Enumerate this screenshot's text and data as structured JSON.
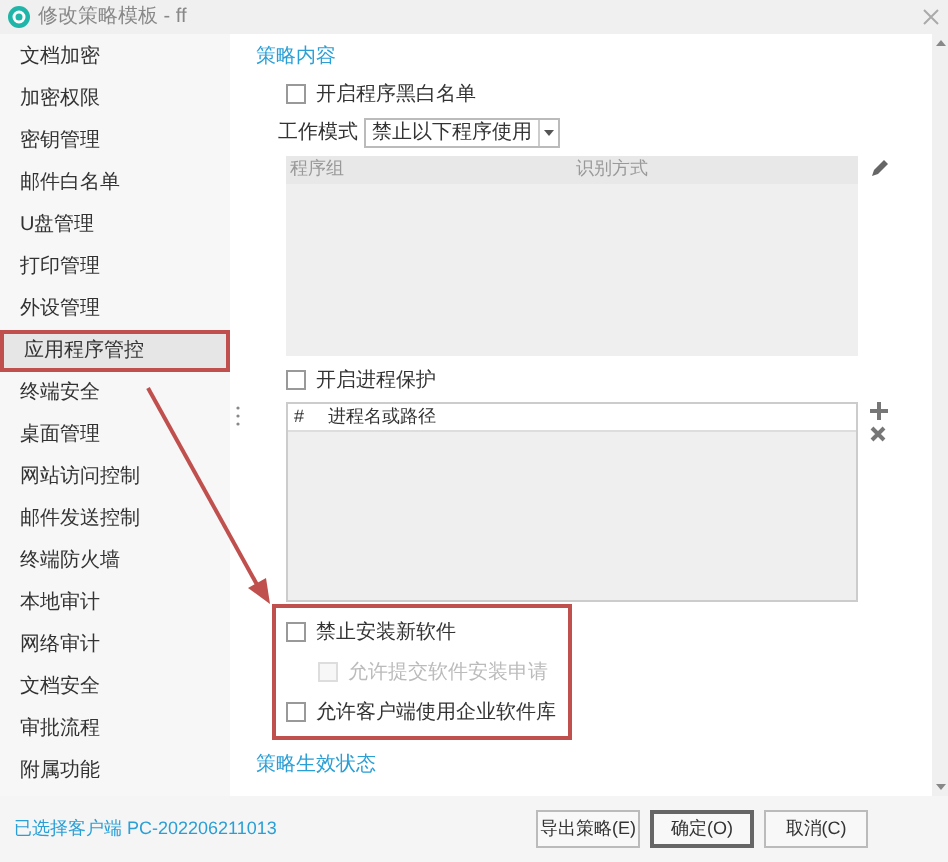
{
  "window": {
    "title": "修改策略模板 - ff"
  },
  "sidebar": {
    "items": [
      {
        "label": "文档加密",
        "selected": false
      },
      {
        "label": "加密权限",
        "selected": false
      },
      {
        "label": "密钥管理",
        "selected": false
      },
      {
        "label": "邮件白名单",
        "selected": false
      },
      {
        "label": "U盘管理",
        "selected": false
      },
      {
        "label": "打印管理",
        "selected": false
      },
      {
        "label": "外设管理",
        "selected": false
      },
      {
        "label": "应用程序管控",
        "selected": true
      },
      {
        "label": "终端安全",
        "selected": false
      },
      {
        "label": "桌面管理",
        "selected": false
      },
      {
        "label": "网站访问控制",
        "selected": false
      },
      {
        "label": "邮件发送控制",
        "selected": false
      },
      {
        "label": "终端防火墙",
        "selected": false
      },
      {
        "label": "本地审计",
        "selected": false
      },
      {
        "label": "网络审计",
        "selected": false
      },
      {
        "label": "文档安全",
        "selected": false
      },
      {
        "label": "审批流程",
        "selected": false
      },
      {
        "label": "附属功能",
        "selected": false
      }
    ]
  },
  "content": {
    "section_title": "策略内容",
    "whitelist": {
      "label": "开启程序黑白名单",
      "checked": false
    },
    "work_mode": {
      "label": "工作模式",
      "value": "禁止以下程序使用"
    },
    "program_table": {
      "columns": [
        "程序组",
        "识别方式"
      ],
      "disabled": true
    },
    "process_protection": {
      "label": "开启进程保护",
      "checked": false
    },
    "process_table": {
      "columns": [
        "#",
        "进程名或路径"
      ]
    },
    "install_options": [
      {
        "label": "禁止安装新软件",
        "checked": false,
        "disabled": false,
        "children": [
          {
            "label": "允许提交软件安装申请",
            "checked": false,
            "disabled": true
          }
        ]
      },
      {
        "label": "允许客户端使用企业软件库",
        "checked": false,
        "disabled": false
      }
    ],
    "status_section_title": "策略生效状态"
  },
  "footer": {
    "selected_client": "已选择客户端 PC-202206211013",
    "buttons": [
      {
        "label": "导出策略(E)",
        "primary": false
      },
      {
        "label": "确定(O)",
        "primary": true
      },
      {
        "label": "取消(C)",
        "primary": false
      }
    ]
  }
}
